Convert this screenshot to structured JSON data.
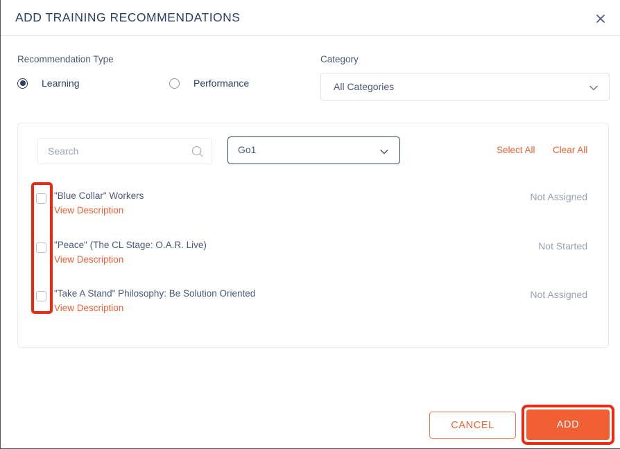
{
  "dialog": {
    "title": "ADD TRAINING RECOMMENDATIONS",
    "close_icon": "close-icon"
  },
  "recommendation_type": {
    "label": "Recommendation Type",
    "options": [
      {
        "label": "Learning",
        "selected": true
      },
      {
        "label": "Performance",
        "selected": false
      }
    ]
  },
  "category": {
    "label": "Category",
    "selected": "All Categories",
    "chevron_icon": "chevron-down-icon"
  },
  "search": {
    "placeholder": "Search",
    "value": "",
    "icon": "search-icon"
  },
  "provider": {
    "selected": "Go1",
    "chevron_icon": "chevron-down-icon"
  },
  "bulk_actions": {
    "select_all": "Select All",
    "clear_all": "Clear All"
  },
  "list": {
    "description_link_label": "View Description",
    "items": [
      {
        "title": "\"Blue Collar\" Workers",
        "description_link": "View Description",
        "status": "Not Assigned",
        "checked": false
      },
      {
        "title": "\"Peace\" (The CL Stage: O.A.R. Live)",
        "description_link": "View Description",
        "status": "Not Started",
        "checked": false
      },
      {
        "title": "\"Take A Stand\" Philosophy: Be Solution Oriented",
        "description_link": "View Description",
        "status": "Not Assigned",
        "checked": false
      }
    ]
  },
  "footer": {
    "cancel_label": "CANCEL",
    "add_label": "ADD"
  },
  "colors": {
    "accent_orange": "#f15f32",
    "navy": "#2b4066",
    "muted_text": "#97a0b3",
    "annotation_red": "#f0280f"
  }
}
